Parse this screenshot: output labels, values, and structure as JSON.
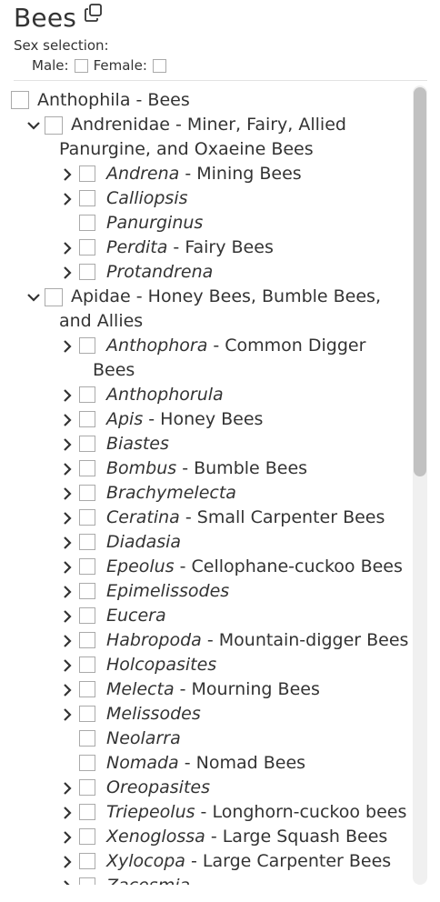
{
  "page": {
    "title": "Bees"
  },
  "sex_selection": {
    "label": "Sex selection:",
    "male_label": "Male:",
    "female_label": "Female:",
    "male_checked": false,
    "female_checked": false
  },
  "tree": {
    "root": {
      "name": "Anthophila",
      "common": " - Bees"
    },
    "families": [
      {
        "name": "Andrenidae",
        "common_line1": " - Miner, Fairy, Allied",
        "common_line2": "Panurgine, and Oxaeine Bees",
        "expanded": true,
        "genera": [
          {
            "name": "Andrena",
            "common": " - Mining Bees",
            "expandable": true
          },
          {
            "name": "Calliopsis",
            "common": "",
            "expandable": true
          },
          {
            "name": "Panurginus",
            "common": "",
            "expandable": false
          },
          {
            "name": "Perdita",
            "common": " - Fairy Bees",
            "expandable": true
          },
          {
            "name": "Protandrena",
            "common": "",
            "expandable": true
          }
        ]
      },
      {
        "name": "Apidae",
        "common_line1": " - Honey Bees, Bumble Bees,",
        "common_line2": "and Allies",
        "expanded": true,
        "genera": [
          {
            "name": "Anthophora",
            "common": " - Common Digger",
            "common_line2": "Bees",
            "expandable": true
          },
          {
            "name": "Anthophorula",
            "common": "",
            "expandable": true
          },
          {
            "name": "Apis",
            "common": " - Honey Bees",
            "expandable": true
          },
          {
            "name": "Biastes",
            "common": "",
            "expandable": true
          },
          {
            "name": "Bombus",
            "common": " - Bumble Bees",
            "expandable": true
          },
          {
            "name": "Brachymelecta",
            "common": "",
            "expandable": true
          },
          {
            "name": "Ceratina",
            "common": " - Small Carpenter Bees",
            "expandable": true
          },
          {
            "name": "Diadasia",
            "common": "",
            "expandable": true
          },
          {
            "name": "Epeolus",
            "common": " - Cellophane-cuckoo Bees",
            "expandable": true
          },
          {
            "name": "Epimelissodes",
            "common": "",
            "expandable": true
          },
          {
            "name": "Eucera",
            "common": "",
            "expandable": true
          },
          {
            "name": "Habropoda",
            "common": " - Mountain-digger Bees",
            "expandable": true
          },
          {
            "name": "Holcopasites",
            "common": "",
            "expandable": true
          },
          {
            "name": "Melecta",
            "common": " - Mourning Bees",
            "expandable": true
          },
          {
            "name": "Melissodes",
            "common": "",
            "expandable": true
          },
          {
            "name": "Neolarra",
            "common": "",
            "expandable": false
          },
          {
            "name": "Nomada",
            "common": " - Nomad Bees",
            "expandable": false
          },
          {
            "name": "Oreopasites",
            "common": "",
            "expandable": true
          },
          {
            "name": "Triepeolus",
            "common": " - Longhorn-cuckoo bees",
            "expandable": true
          },
          {
            "name": "Xenoglossa",
            "common": " - Large Squash Bees",
            "expandable": true
          },
          {
            "name": "Xylocopa",
            "common": " - Large Carpenter Bees",
            "expandable": true
          },
          {
            "name": "Zacesmia",
            "common": "",
            "expandable": true
          }
        ]
      }
    ]
  },
  "icons": {
    "copy": "copy-icon",
    "expand": "chevron-right-icon",
    "collapse": "chevron-down-icon"
  },
  "colors": {
    "text": "#333333",
    "checkbox_border": "#aaaaaa",
    "scroll_track": "#f0f0f0",
    "scroll_thumb": "#c1c1c1"
  }
}
